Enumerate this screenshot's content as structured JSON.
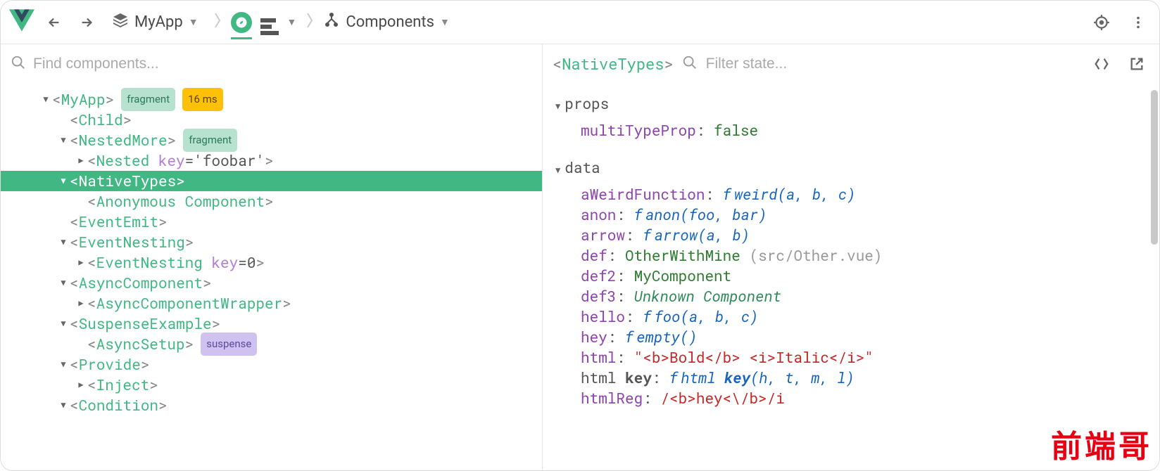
{
  "toolbar": {
    "app_name": "MyApp",
    "breadcrumb_label": "Components"
  },
  "left": {
    "search_placeholder": "Find components...",
    "tree": [
      {
        "depth": 1,
        "toggle": "down",
        "name": "MyApp",
        "badges": [
          {
            "kind": "frag",
            "text": "fragment"
          },
          {
            "kind": "time",
            "text": "16 ms"
          }
        ]
      },
      {
        "depth": 2,
        "toggle": "none",
        "name": "Child"
      },
      {
        "depth": 2,
        "toggle": "down",
        "name": "NestedMore",
        "badges": [
          {
            "kind": "frag",
            "text": "fragment"
          }
        ]
      },
      {
        "depth": 3,
        "toggle": "right",
        "name": "Nested",
        "attr": "key",
        "attrv": "'foobar'"
      },
      {
        "depth": 2,
        "toggle": "down",
        "name": "NativeTypes",
        "selected": true
      },
      {
        "depth": 3,
        "toggle": "none",
        "name": "Anonymous Component"
      },
      {
        "depth": 2,
        "toggle": "none",
        "name": "EventEmit"
      },
      {
        "depth": 2,
        "toggle": "down",
        "name": "EventNesting"
      },
      {
        "depth": 3,
        "toggle": "right",
        "name": "EventNesting",
        "attr": "key",
        "attrv": "0"
      },
      {
        "depth": 2,
        "toggle": "down",
        "name": "AsyncComponent"
      },
      {
        "depth": 3,
        "toggle": "right",
        "name": "AsyncComponentWrapper"
      },
      {
        "depth": 2,
        "toggle": "down",
        "name": "SuspenseExample"
      },
      {
        "depth": 3,
        "toggle": "none",
        "name": "AsyncSetup",
        "badges": [
          {
            "kind": "susp",
            "text": "suspense"
          }
        ]
      },
      {
        "depth": 2,
        "toggle": "down",
        "name": "Provide"
      },
      {
        "depth": 3,
        "toggle": "right",
        "name": "Inject"
      },
      {
        "depth": 2,
        "toggle": "down",
        "name": "Condition"
      }
    ]
  },
  "right": {
    "selected_component": "NativeTypes",
    "filter_placeholder": "Filter state...",
    "sections": [
      {
        "title": "props",
        "items": [
          {
            "key": "multiTypeProp",
            "kind": "bool",
            "value": "false"
          }
        ]
      },
      {
        "title": "data",
        "items": [
          {
            "key": "aWeirdFunction",
            "kind": "fn",
            "value": "weird(a, b, c)"
          },
          {
            "key": "anon",
            "kind": "fn",
            "value": "anon(foo, bar)"
          },
          {
            "key": "arrow",
            "kind": "fn",
            "value": "arrow(a, b)"
          },
          {
            "key": "def",
            "kind": "comp",
            "value": "OtherWithMine",
            "hint": "(src/Other.vue)"
          },
          {
            "key": "def2",
            "kind": "comp",
            "value": "MyComponent"
          },
          {
            "key": "def3",
            "kind": "unk",
            "value": "Unknown Component"
          },
          {
            "key": "hello",
            "kind": "fn",
            "value": "foo(a, b, c)"
          },
          {
            "key": "hey",
            "kind": "fn",
            "value": "empty()"
          },
          {
            "key": "html",
            "kind": "str",
            "value": "\"<b>Bold</b> <i>Italic</i>\""
          },
          {
            "rawkey": "html <b>key</b>",
            "kind": "fn",
            "value": "html <b>key</b>(h, t, m, l)"
          },
          {
            "key": "htmlReg",
            "kind": "reg",
            "value": "/<b>hey<\\/b>/i"
          }
        ]
      }
    ]
  },
  "watermark": "前端哥"
}
